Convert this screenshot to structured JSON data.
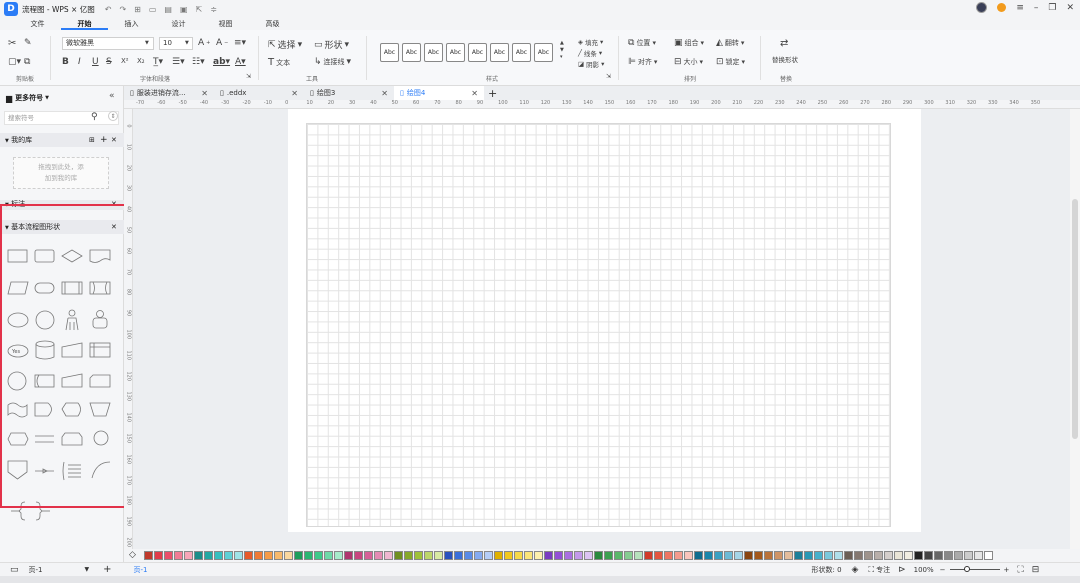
{
  "app": {
    "title": "流程图 - WPS × 亿图",
    "logo_text": "D"
  },
  "menu": [
    "文件",
    "开始",
    "插入",
    "设计",
    "视图",
    "高级"
  ],
  "ribbon": {
    "clipboard_label": "剪贴板",
    "font_label": "字体和段落",
    "font_name": "微软雅黑",
    "font_size": "10",
    "tools_label": "工具",
    "select": "选择",
    "shape": "形状",
    "text": "文本",
    "connector": "连接线",
    "style_label": "样式",
    "style_box": "Abc",
    "fill": "填充",
    "line": "线条",
    "shadow": "阴影",
    "arrange_label": "排列",
    "position": "位置",
    "combine": "组合",
    "flip": "翻转",
    "align": "对齐",
    "size": "大小",
    "lock": "锁定",
    "replace_label": "替换",
    "replace_shape": "替换形状"
  },
  "tabs": [
    {
      "label": "服装进销存流..."
    },
    {
      "label": ".eddx"
    },
    {
      "label": "绘图3"
    },
    {
      "label": "绘图4"
    }
  ],
  "left": {
    "more_symbols": "更多符号",
    "search_placeholder": "搜索符号",
    "my_library": "我的库",
    "drop_hint_1": "拖拽到此处，添",
    "drop_hint_2": "加到我的库",
    "annotation": "标注",
    "basic_flow": "基本流程图形状",
    "yes_label": "Yes"
  },
  "ruler_h": [
    "-70",
    "-60",
    "-50",
    "-40",
    "-30",
    "-20",
    "-10",
    "0",
    "10",
    "20",
    "30",
    "40",
    "50",
    "60",
    "70",
    "80",
    "90",
    "100",
    "110",
    "120",
    "130",
    "140",
    "150",
    "160",
    "170",
    "180",
    "190",
    "200",
    "210",
    "220",
    "230",
    "240",
    "250",
    "260",
    "270",
    "280",
    "290",
    "300",
    "310",
    "320",
    "330",
    "340",
    "350"
  ],
  "ruler_v": [
    "0",
    "10",
    "20",
    "30",
    "40",
    "50",
    "60",
    "70",
    "80",
    "90",
    "100",
    "110",
    "120",
    "130",
    "140",
    "150",
    "160",
    "170",
    "180",
    "190",
    "200"
  ],
  "palette_colors": [
    "#c0392b",
    "#e03c4a",
    "#e94f6a",
    "#f07c95",
    "#f7a6b8",
    "#1b8f8a",
    "#24a8a3",
    "#36bfbf",
    "#5fd0d6",
    "#9fe3e8",
    "#e85b2a",
    "#f07a35",
    "#f59b48",
    "#f7b96c",
    "#f9d79f",
    "#1e9e5c",
    "#2bb673",
    "#3ec98a",
    "#6fd9a8",
    "#a7ebca",
    "#b0356e",
    "#c8467f",
    "#d66197",
    "#e38bb3",
    "#eeb7d0",
    "#6f8f20",
    "#86a82a",
    "#9fc13a",
    "#bdd66a",
    "#d8e9a3",
    "#2a52be",
    "#3b6fd9",
    "#5a8be6",
    "#85aaef",
    "#b5cdf6",
    "#e0b100",
    "#f2c81f",
    "#f7d94a",
    "#fae47a",
    "#fcefad",
    "#7a3cc2",
    "#9350d6",
    "#a96fe0",
    "#c399ea",
    "#dcc3f3",
    "#2a8a3e",
    "#3ca050",
    "#5bb76a",
    "#86cc91",
    "#b6e1bc",
    "#d23b2a",
    "#e4553f",
    "#ee7563",
    "#f49b8d",
    "#f9c4bb",
    "#0f6d8f",
    "#1a86ab",
    "#3aa0c2",
    "#6dbad6",
    "#a5d5e8",
    "#8a4510",
    "#a3581c",
    "#b9723a",
    "#cf9466",
    "#e4bd9c",
    "#1c7f9a",
    "#2a98b5",
    "#48b0cb",
    "#7bc8dc",
    "#b0dfeb",
    "#6b5e55",
    "#847770",
    "#9e938c",
    "#b8afaa",
    "#d4cecb",
    "#e9e4d6",
    "#f1ede2",
    "#222222",
    "#444444",
    "#666666",
    "#888888",
    "#aaaaaa",
    "#cccccc",
    "#e6e6e6",
    "#ffffff"
  ],
  "status": {
    "page_selector": "页-1",
    "page_tab": "页-1",
    "shape_count": "形状数: 0",
    "focus": "专注",
    "zoom": "100%"
  }
}
